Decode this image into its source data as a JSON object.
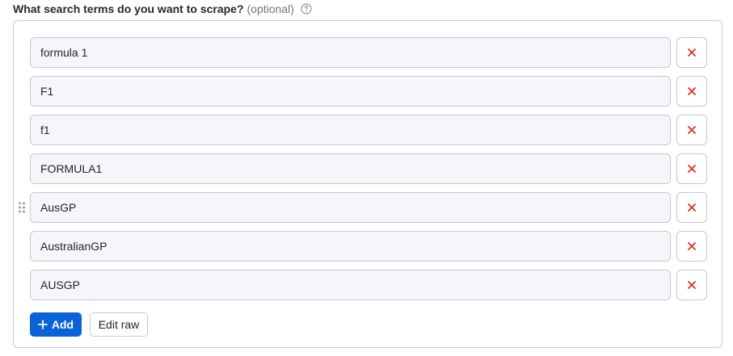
{
  "field": {
    "label": "What search terms do you want to scrape?",
    "optional": "(optional)",
    "help_icon": "question-circle-icon"
  },
  "terms": [
    {
      "value": "formula 1"
    },
    {
      "value": "F1"
    },
    {
      "value": "f1"
    },
    {
      "value": "FORMULA1"
    },
    {
      "value": "AusGP"
    },
    {
      "value": "AustralianGP"
    },
    {
      "value": "AUSGP"
    }
  ],
  "actions": {
    "add_label": "Add",
    "add_icon": "plus-icon",
    "edit_raw_label": "Edit raw",
    "remove_icon": "close-icon",
    "drag_icon": "drag-handle-icon"
  },
  "colors": {
    "accent": "#0a63d6",
    "remove": "#d93025"
  }
}
